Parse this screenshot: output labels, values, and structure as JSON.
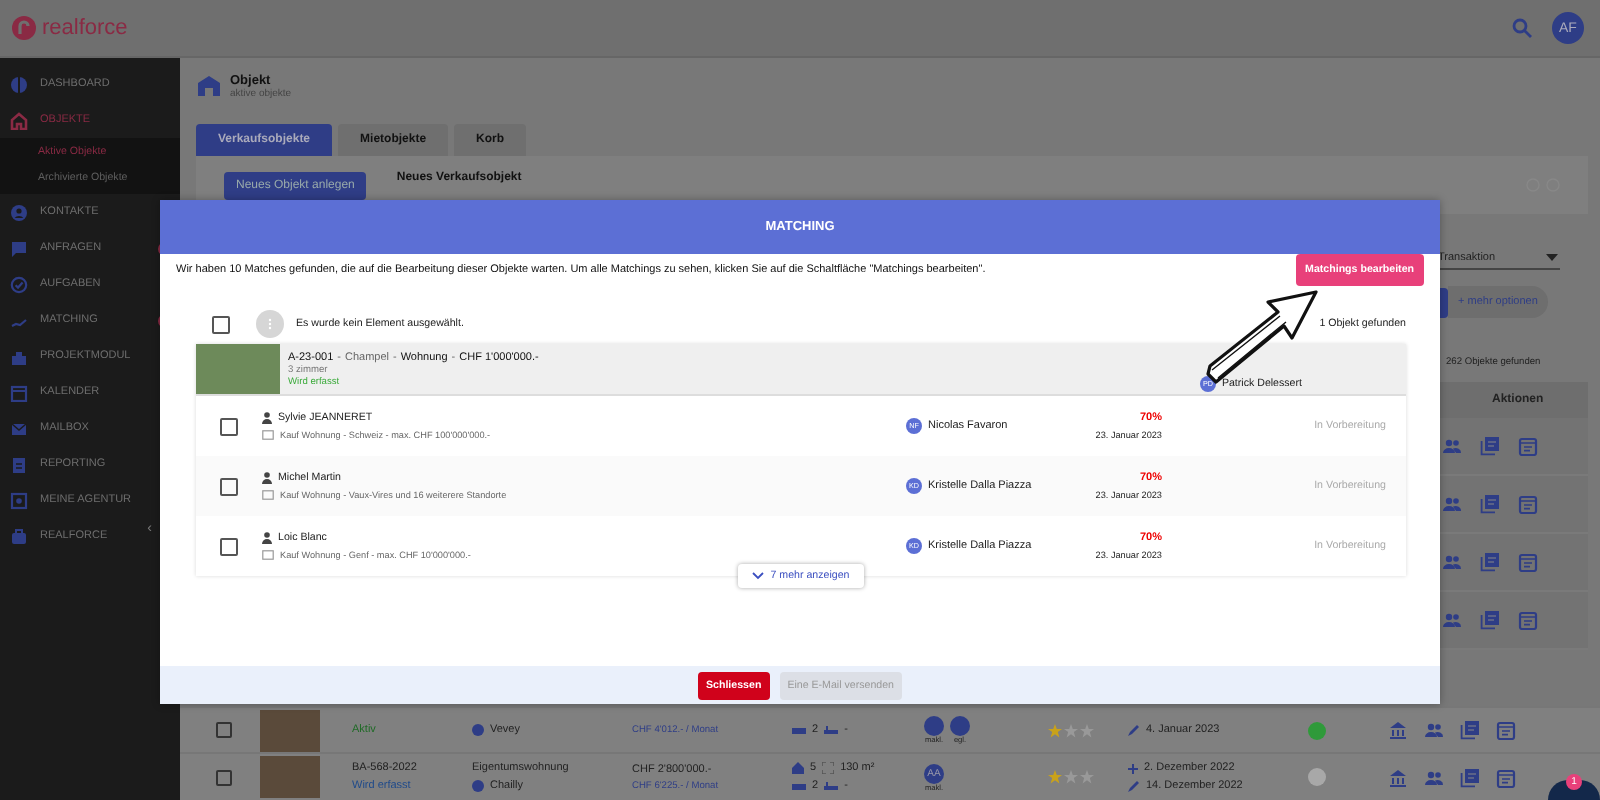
{
  "topbar": {
    "logo": "realforce",
    "avatar": "AF"
  },
  "sidebar": {
    "items": [
      {
        "label": "DASHBOARD",
        "selected": false,
        "badge": false
      },
      {
        "label": "OBJEKTE",
        "selected": true,
        "badge": false,
        "children": [
          {
            "label": "Aktive Objekte",
            "selected": true
          },
          {
            "label": "Archivierte Objekte",
            "selected": false
          }
        ]
      },
      {
        "label": "KONTAKTE",
        "selected": false,
        "badge": false
      },
      {
        "label": "ANFRAGEN",
        "selected": false,
        "badge": true
      },
      {
        "label": "AUFGABEN",
        "selected": false,
        "badge": false
      },
      {
        "label": "MATCHING",
        "selected": false,
        "badge": true
      },
      {
        "label": "PROJEKTMODUL",
        "selected": false,
        "badge": false
      },
      {
        "label": "KALENDER",
        "selected": false,
        "badge": false
      },
      {
        "label": "MAILBOX",
        "selected": false,
        "badge": false
      },
      {
        "label": "REPORTING",
        "selected": false,
        "badge": false
      },
      {
        "label": "MEINE AGENTUR",
        "selected": false,
        "badge": false
      },
      {
        "label": "REALFORCE",
        "selected": false,
        "badge": false
      }
    ],
    "collapse": "‹"
  },
  "page": {
    "title": "Objekt",
    "subtitle": "aktive objekte"
  },
  "tabs": [
    {
      "label": "Verkaufsobjekte",
      "selected": true
    },
    {
      "label": "Mietobjekte",
      "selected": false
    },
    {
      "label": "Korb",
      "selected": false
    }
  ],
  "toolbar": {
    "button": "Neues Objekt anlegen",
    "label": "Neues Verkaufsobjekt"
  },
  "filters": {
    "transaction": "Transaktion",
    "more": "+ mehr optionen",
    "count": "262 Objekte gefunden",
    "actions_header": "Aktionen"
  },
  "modal": {
    "title": "MATCHING",
    "message": "Wir haben 10 Matches gefunden, die auf die Bearbeitung dieser Objekte warten. Um alle Matchings zu sehen, klicken Sie auf die Schaltfläche \"Matchings bearbeiten\".",
    "edit_button": "Matchings bearbeiten",
    "selection": {
      "checked": false,
      "text": "Es wurde kein Element ausgewählt.",
      "count": "1 Objekt gefunden"
    },
    "object": {
      "reference": "A-23-001",
      "separators": [
        "-",
        "-",
        "-"
      ],
      "location": "Champel",
      "type": "Wohnung",
      "price": "CHF 1'000'000.-",
      "rooms": "3 zimmer",
      "status": "Wird erfasst",
      "agent": "Patrick Delessert",
      "agent_initials": "PD"
    },
    "matches": [
      {
        "checked": false,
        "name": "Sylvie JEANNERET",
        "criteria": "Kauf Wohnung - Schweiz - max. CHF 100'000'000.-",
        "agent_initials": "NF",
        "agent": "Nicolas Favaron",
        "score": "70%",
        "date": "23. Januar 2023",
        "status": "In Vorbereitung"
      },
      {
        "checked": false,
        "name": "Michel Martin",
        "criteria": "Kauf Wohnung - Vaux-Vires und 16 weiterere Standorte",
        "agent_initials": "KD",
        "agent": "Kristelle Dalla Piazza",
        "score": "70%",
        "date": "23. Januar 2023",
        "status": "In Vorbereitung"
      },
      {
        "checked": false,
        "name": "Loic Blanc",
        "criteria": "Kauf Wohnung - Genf - max. CHF 10'000'000.-",
        "agent_initials": "KD",
        "agent": "Kristelle Dalla Piazza",
        "score": "70%",
        "date": "23. Januar 2023",
        "status": "In Vorbereitung"
      }
    ],
    "show_more": "7 mehr anzeigen",
    "buttons": [
      {
        "label": "Schliessen",
        "kind": "danger",
        "disabled": false
      },
      {
        "label": "Eine E-Mail versenden",
        "kind": "plain",
        "disabled": true
      }
    ]
  },
  "rows": [
    {
      "checked": false,
      "status": {
        "text": "Aktiv",
        "color": "#1f6a26"
      },
      "location": "Vevey",
      "rent": "CHF 4'012.- / Monat",
      "beds": "2",
      "baths": "-",
      "agents": [
        {
          "label": "makl."
        },
        {
          "label": "egl."
        }
      ],
      "stars": 1,
      "modified": "4. Januar 2023",
      "color": "#2f9a3a"
    },
    {
      "checked": false,
      "reference": "BA-568-2022",
      "status": {
        "text": "Wird erfasst",
        "color": "#1f4a8a"
      },
      "type": "Eigentumswohnung",
      "location": "Chailly",
      "price": "CHF 2'800'000.-",
      "rent": "CHF 6'225.- / Monat",
      "rooms": "5",
      "area": "130 m²",
      "beds": "2",
      "baths": "-",
      "agents": [
        {
          "initials": "AA",
          "label": "makl."
        }
      ],
      "stars": 1,
      "created": "2. Dezember 2022",
      "modified": "14. Dezember 2022",
      "color": "#a8a8a8"
    }
  ],
  "chat": {
    "badge": "1"
  }
}
